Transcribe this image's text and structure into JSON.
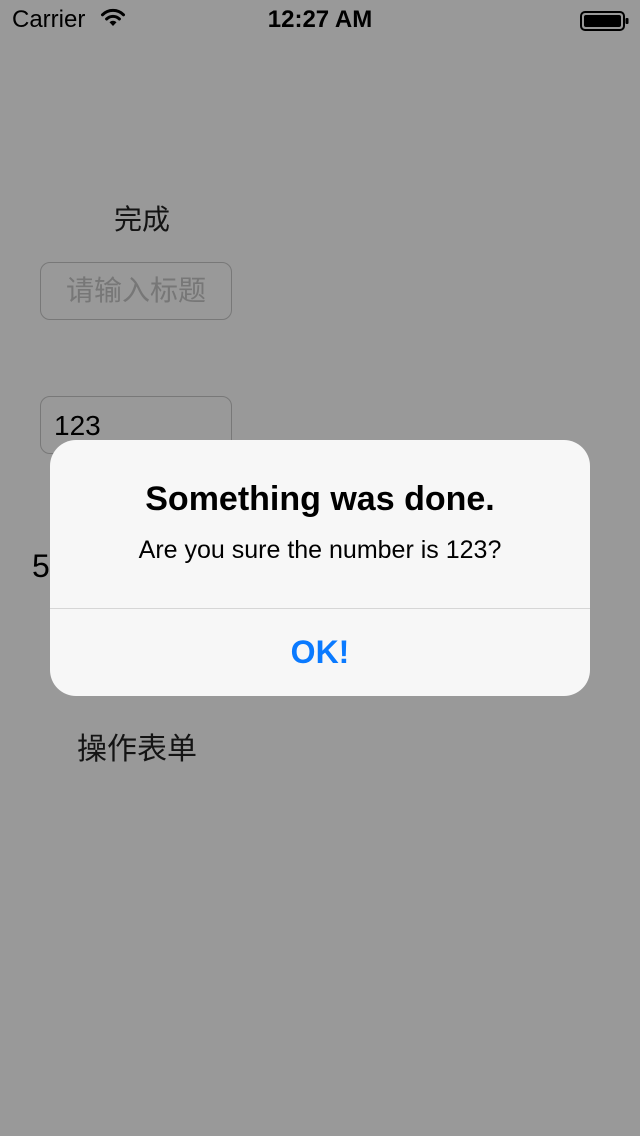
{
  "status_bar": {
    "carrier": "Carrier",
    "wifi_icon": "wifi-icon",
    "time": "12:27 AM",
    "battery_icon": "battery-full-icon"
  },
  "main": {
    "done_label": "完成",
    "title_input_placeholder": "请输入标题",
    "number_value": "123",
    "partial_label": "5",
    "action_sheet_label": "操作表单"
  },
  "alert": {
    "title": "Something was done.",
    "message": "Are you sure the number is 123?",
    "ok_label": "OK!"
  },
  "colors": {
    "accent": "#0a7aff",
    "overlay": "rgba(0,0,0,0.40)",
    "alert_background": "#f7f7f7"
  }
}
